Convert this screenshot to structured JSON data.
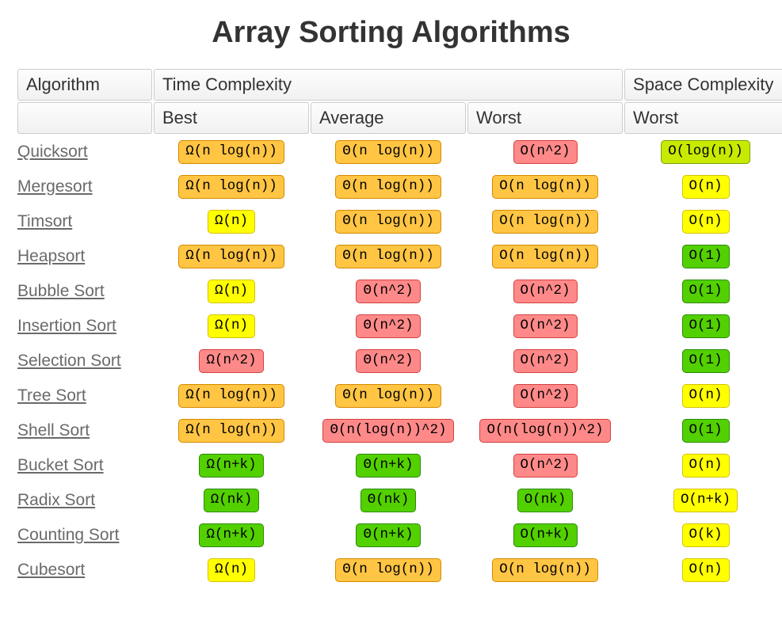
{
  "title": "Array Sorting Algorithms",
  "headers": {
    "algorithm": "Algorithm",
    "time": "Time Complexity",
    "space": "Space Complexity",
    "best": "Best",
    "average": "Average",
    "worst": "Worst",
    "space_worst": "Worst"
  },
  "color_map": {
    "green": "#53d000",
    "yellowgreen": "#c8ea00",
    "yellow": "#ffff00",
    "orange": "#ffc543",
    "red": "#ff8989"
  },
  "rows": [
    {
      "name": "Quicksort",
      "best": {
        "text": "Ω(n log(n))",
        "color": "orange"
      },
      "avg": {
        "text": "Θ(n log(n))",
        "color": "orange"
      },
      "worst": {
        "text": "O(n^2)",
        "color": "red"
      },
      "space": {
        "text": "O(log(n))",
        "color": "yellowgreen"
      }
    },
    {
      "name": "Mergesort",
      "best": {
        "text": "Ω(n log(n))",
        "color": "orange"
      },
      "avg": {
        "text": "Θ(n log(n))",
        "color": "orange"
      },
      "worst": {
        "text": "O(n log(n))",
        "color": "orange"
      },
      "space": {
        "text": "O(n)",
        "color": "yellow"
      }
    },
    {
      "name": "Timsort",
      "best": {
        "text": "Ω(n)",
        "color": "yellow"
      },
      "avg": {
        "text": "Θ(n log(n))",
        "color": "orange"
      },
      "worst": {
        "text": "O(n log(n))",
        "color": "orange"
      },
      "space": {
        "text": "O(n)",
        "color": "yellow"
      }
    },
    {
      "name": "Heapsort",
      "best": {
        "text": "Ω(n log(n))",
        "color": "orange"
      },
      "avg": {
        "text": "Θ(n log(n))",
        "color": "orange"
      },
      "worst": {
        "text": "O(n log(n))",
        "color": "orange"
      },
      "space": {
        "text": "O(1)",
        "color": "green"
      }
    },
    {
      "name": "Bubble Sort",
      "best": {
        "text": "Ω(n)",
        "color": "yellow"
      },
      "avg": {
        "text": "Θ(n^2)",
        "color": "red"
      },
      "worst": {
        "text": "O(n^2)",
        "color": "red"
      },
      "space": {
        "text": "O(1)",
        "color": "green"
      }
    },
    {
      "name": "Insertion Sort",
      "best": {
        "text": "Ω(n)",
        "color": "yellow"
      },
      "avg": {
        "text": "Θ(n^2)",
        "color": "red"
      },
      "worst": {
        "text": "O(n^2)",
        "color": "red"
      },
      "space": {
        "text": "O(1)",
        "color": "green"
      }
    },
    {
      "name": "Selection Sort",
      "best": {
        "text": "Ω(n^2)",
        "color": "red"
      },
      "avg": {
        "text": "Θ(n^2)",
        "color": "red"
      },
      "worst": {
        "text": "O(n^2)",
        "color": "red"
      },
      "space": {
        "text": "O(1)",
        "color": "green"
      }
    },
    {
      "name": "Tree Sort",
      "best": {
        "text": "Ω(n log(n))",
        "color": "orange"
      },
      "avg": {
        "text": "Θ(n log(n))",
        "color": "orange"
      },
      "worst": {
        "text": "O(n^2)",
        "color": "red"
      },
      "space": {
        "text": "O(n)",
        "color": "yellow"
      }
    },
    {
      "name": "Shell Sort",
      "best": {
        "text": "Ω(n log(n))",
        "color": "orange"
      },
      "avg": {
        "text": "Θ(n(log(n))^2)",
        "color": "red"
      },
      "worst": {
        "text": "O(n(log(n))^2)",
        "color": "red"
      },
      "space": {
        "text": "O(1)",
        "color": "green"
      }
    },
    {
      "name": "Bucket Sort",
      "best": {
        "text": "Ω(n+k)",
        "color": "green"
      },
      "avg": {
        "text": "Θ(n+k)",
        "color": "green"
      },
      "worst": {
        "text": "O(n^2)",
        "color": "red"
      },
      "space": {
        "text": "O(n)",
        "color": "yellow"
      }
    },
    {
      "name": "Radix Sort",
      "best": {
        "text": "Ω(nk)",
        "color": "green"
      },
      "avg": {
        "text": "Θ(nk)",
        "color": "green"
      },
      "worst": {
        "text": "O(nk)",
        "color": "green"
      },
      "space": {
        "text": "O(n+k)",
        "color": "yellow"
      }
    },
    {
      "name": "Counting Sort",
      "best": {
        "text": "Ω(n+k)",
        "color": "green"
      },
      "avg": {
        "text": "Θ(n+k)",
        "color": "green"
      },
      "worst": {
        "text": "O(n+k)",
        "color": "green"
      },
      "space": {
        "text": "O(k)",
        "color": "yellow"
      }
    },
    {
      "name": "Cubesort",
      "best": {
        "text": "Ω(n)",
        "color": "yellow"
      },
      "avg": {
        "text": "Θ(n log(n))",
        "color": "orange"
      },
      "worst": {
        "text": "O(n log(n))",
        "color": "orange"
      },
      "space": {
        "text": "O(n)",
        "color": "yellow"
      }
    }
  ],
  "chart_data": {
    "type": "table",
    "title": "Array Sorting Algorithms",
    "columns": [
      "Algorithm",
      "Time Best",
      "Time Average",
      "Time Worst",
      "Space Worst"
    ],
    "rows": [
      [
        "Quicksort",
        "Ω(n log(n))",
        "Θ(n log(n))",
        "O(n^2)",
        "O(log(n))"
      ],
      [
        "Mergesort",
        "Ω(n log(n))",
        "Θ(n log(n))",
        "O(n log(n))",
        "O(n)"
      ],
      [
        "Timsort",
        "Ω(n)",
        "Θ(n log(n))",
        "O(n log(n))",
        "O(n)"
      ],
      [
        "Heapsort",
        "Ω(n log(n))",
        "Θ(n log(n))",
        "O(n log(n))",
        "O(1)"
      ],
      [
        "Bubble Sort",
        "Ω(n)",
        "Θ(n^2)",
        "O(n^2)",
        "O(1)"
      ],
      [
        "Insertion Sort",
        "Ω(n)",
        "Θ(n^2)",
        "O(n^2)",
        "O(1)"
      ],
      [
        "Selection Sort",
        "Ω(n^2)",
        "Θ(n^2)",
        "O(n^2)",
        "O(1)"
      ],
      [
        "Tree Sort",
        "Ω(n log(n))",
        "Θ(n log(n))",
        "O(n^2)",
        "O(n)"
      ],
      [
        "Shell Sort",
        "Ω(n log(n))",
        "Θ(n(log(n))^2)",
        "O(n(log(n))^2)",
        "O(1)"
      ],
      [
        "Bucket Sort",
        "Ω(n+k)",
        "Θ(n+k)",
        "O(n^2)",
        "O(n)"
      ],
      [
        "Radix Sort",
        "Ω(nk)",
        "Θ(nk)",
        "O(nk)",
        "O(n+k)"
      ],
      [
        "Counting Sort",
        "Ω(n+k)",
        "Θ(n+k)",
        "O(n+k)",
        "O(k)"
      ],
      [
        "Cubesort",
        "Ω(n)",
        "Θ(n log(n))",
        "O(n log(n))",
        "O(n)"
      ]
    ]
  }
}
